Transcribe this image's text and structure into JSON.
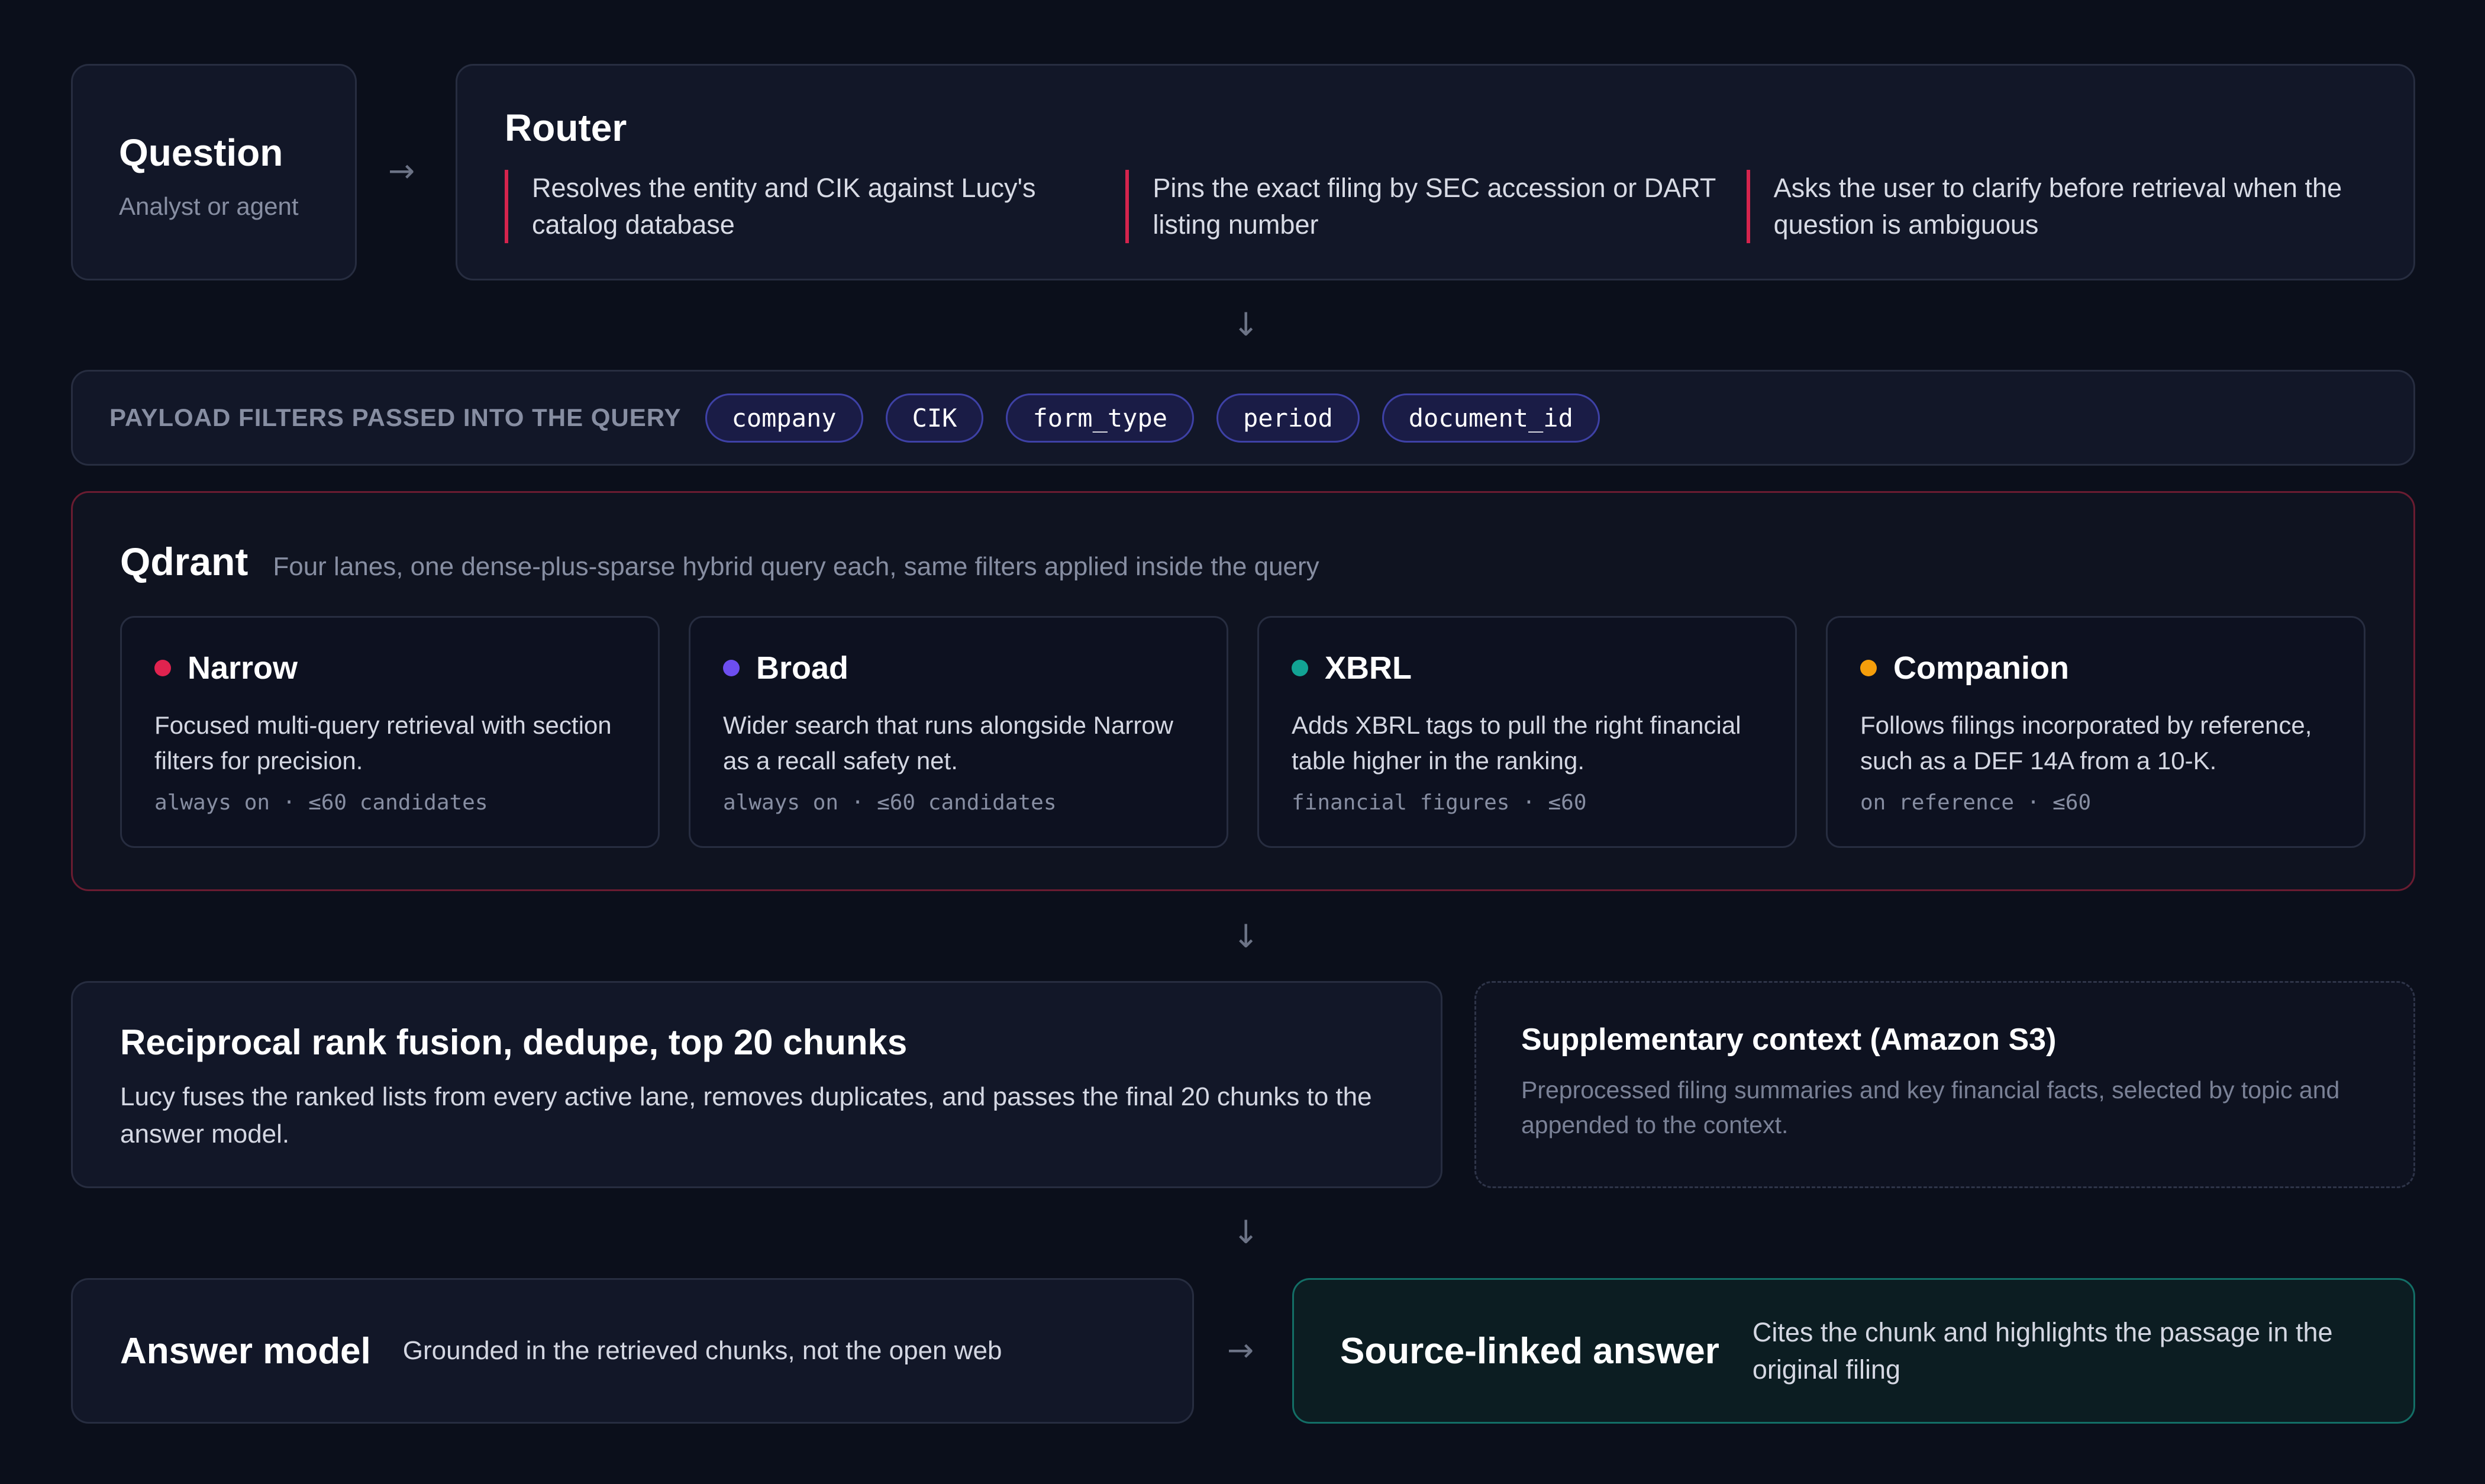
{
  "question": {
    "title": "Question",
    "subtitle": "Analyst or agent"
  },
  "router": {
    "title": "Router",
    "items": [
      "Resolves the entity and CIK against Lucy's catalog database",
      "Pins the exact filing by SEC accession or DART listing number",
      "Asks the user to clarify before retrieval when the question is ambiguous"
    ]
  },
  "payload": {
    "label": "PAYLOAD FILTERS PASSED INTO THE QUERY",
    "filters": [
      "company",
      "CIK",
      "form_type",
      "period",
      "document_id"
    ]
  },
  "qdrant": {
    "title": "Qdrant",
    "subtitle": "Four lanes, one dense-plus-sparse hybrid query each, same filters applied inside the query",
    "lanes": [
      {
        "name": "Narrow",
        "color": "#e0234f",
        "description": "Focused multi-query retrieval with section filters for precision.",
        "meta": "always on · ≤60 candidates"
      },
      {
        "name": "Broad",
        "color": "#6d4ef0",
        "description": "Wider search that runs alongside Narrow as a recall safety net.",
        "meta": "always on · ≤60 candidates"
      },
      {
        "name": "XBRL",
        "color": "#12a394",
        "description": "Adds XBRL tags to pull the right financial table higher in the ranking.",
        "meta": "financial figures · ≤60"
      },
      {
        "name": "Companion",
        "color": "#f59e0b",
        "description": "Follows filings incorporated by reference, such as a DEF 14A from a 10-K.",
        "meta": "on reference · ≤60"
      }
    ]
  },
  "fusion": {
    "title": "Reciprocal rank fusion, dedupe, top 20 chunks",
    "description": "Lucy fuses the ranked lists from every active lane, removes duplicates, and passes the final 20 chunks to the answer model."
  },
  "supplementary": {
    "title": "Supplementary context (Amazon S3)",
    "description": "Preprocessed filing summaries and key financial facts, selected by topic and appended to the context."
  },
  "answer_model": {
    "title": "Answer model",
    "subtitle": "Grounded in the retrieved chunks, not the open web"
  },
  "source_answer": {
    "title": "Source-linked answer",
    "subtitle": "Cites the chunk and highlights the passage in the original filing"
  },
  "arrows": {
    "right": "→",
    "down": "↓"
  }
}
